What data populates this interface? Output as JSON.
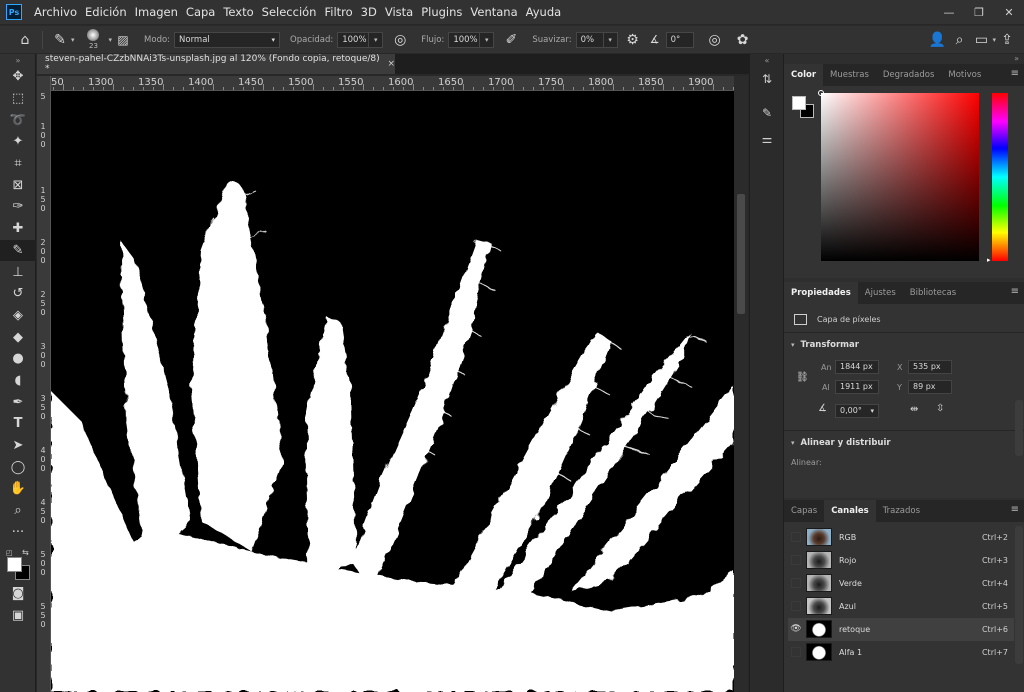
{
  "app": {
    "logo_text": "Ps"
  },
  "menu": [
    "Archivo",
    "Edición",
    "Imagen",
    "Capa",
    "Texto",
    "Selección",
    "Filtro",
    "3D",
    "Vista",
    "Plugins",
    "Ventana",
    "Ayuda"
  ],
  "window_controls": {
    "minimize": "—",
    "restore": "❐",
    "close": "✕"
  },
  "options": {
    "brush_size": "23",
    "mode_label": "Modo:",
    "mode_value": "Normal",
    "opacity_label": "Opacidad:",
    "opacity_value": "100%",
    "flow_label": "Flujo:",
    "flow_value": "100%",
    "smooth_label": "Suavizar:",
    "smooth_value": "0%",
    "angle_value": "0°"
  },
  "document": {
    "tab_title": "steven-pahel-CZzbNNAi3Ts-unsplash.jpg al 120% (Fondo copia, retoque/8) *",
    "tab_close": "×"
  },
  "ruler": {
    "h_labels": [
      "50",
      "1300",
      "1350",
      "1400",
      "1450",
      "1500",
      "1550",
      "1600",
      "1650",
      "1700",
      "1750",
      "1800",
      "1850",
      "1900"
    ],
    "v_labels": [
      "5",
      "1\n0\n0",
      "1\n5\n0",
      "2\n0\n0",
      "2\n5\n0",
      "3\n0\n0",
      "3\n5\n0",
      "4\n0\n0",
      "4\n5\n0",
      "5\n0\n0",
      "5\n5\n0"
    ]
  },
  "color_panel": {
    "tabs": [
      "Color",
      "Muestras",
      "Degradados",
      "Motivos"
    ],
    "active_tab": "Color",
    "foreground": "#ffffff",
    "background": "#000000",
    "hue_color": "#ff0000"
  },
  "properties_panel": {
    "tabs": [
      "Propiedades",
      "Ajustes",
      "Bibliotecas"
    ],
    "active_tab": "Propiedades",
    "layer_type": "Capa de píxeles",
    "transform_title": "Transformar",
    "width_label": "An",
    "width_value": "1844 px",
    "height_label": "Al",
    "height_value": "1911 px",
    "x_label": "X",
    "x_value": "535 px",
    "y_label": "Y",
    "y_value": "89 px",
    "angle_value": "0,00°",
    "align_title": "Alinear y distribuir",
    "align_label": "Alinear:"
  },
  "channels_panel": {
    "tabs": [
      "Capas",
      "Canales",
      "Trazados"
    ],
    "active_tab": "Canales",
    "channels": [
      {
        "name": "RGB",
        "shortcut": "Ctrl+2",
        "visible": false,
        "kind": "color"
      },
      {
        "name": "Rojo",
        "shortcut": "Ctrl+3",
        "visible": false,
        "kind": "gray"
      },
      {
        "name": "Verde",
        "shortcut": "Ctrl+4",
        "visible": false,
        "kind": "gray"
      },
      {
        "name": "Azul",
        "shortcut": "Ctrl+5",
        "visible": false,
        "kind": "gray"
      },
      {
        "name": "retoque",
        "shortcut": "Ctrl+6",
        "visible": true,
        "kind": "mask"
      },
      {
        "name": "Alfa 1",
        "shortcut": "Ctrl+7",
        "visible": false,
        "kind": "mask"
      }
    ]
  }
}
